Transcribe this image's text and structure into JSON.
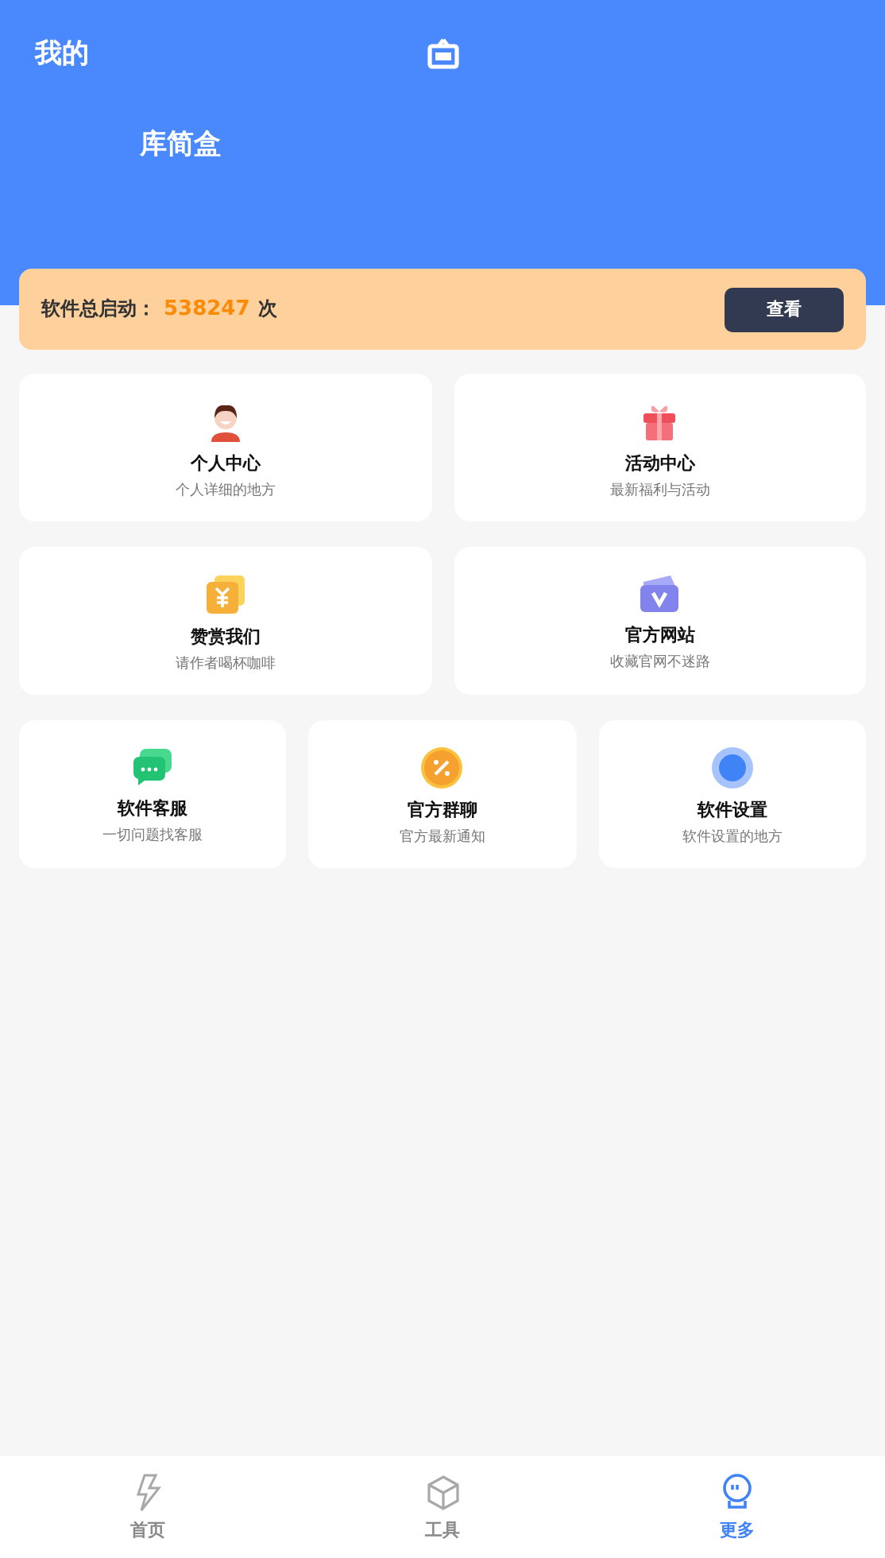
{
  "header": {
    "title": "我的",
    "app_name": "库简盒"
  },
  "banner": {
    "label": "软件总启动：",
    "count": "538247",
    "unit": "次",
    "button": "查看"
  },
  "card_rows": [
    [
      {
        "title": "个人中心",
        "subtitle": "个人详细的地方"
      },
      {
        "title": "活动中心",
        "subtitle": "最新福利与活动"
      }
    ],
    [
      {
        "title": "赞赏我们",
        "subtitle": "请作者喝杯咖啡"
      },
      {
        "title": "官方网站",
        "subtitle": "收藏官网不迷路"
      }
    ],
    [
      {
        "title": "软件客服",
        "subtitle": "一切问题找客服"
      },
      {
        "title": "官方群聊",
        "subtitle": "官方最新通知"
      },
      {
        "title": "软件设置",
        "subtitle": "软件设置的地方"
      }
    ]
  ],
  "tab_bar": [
    {
      "label": "首页",
      "selected": false
    },
    {
      "label": "工具",
      "selected": false
    },
    {
      "label": "更多",
      "selected": true
    }
  ]
}
